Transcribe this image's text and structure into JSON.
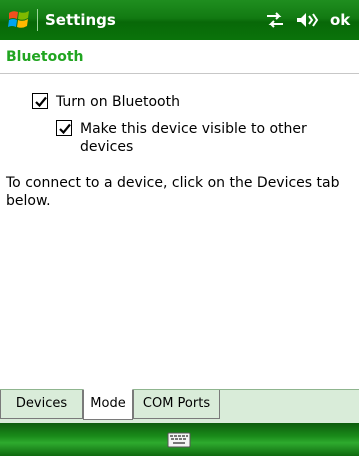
{
  "titlebar": {
    "title": "Settings",
    "ok_label": "ok",
    "icons": [
      "windows-start-icon",
      "connectivity-icon",
      "volume-icon"
    ]
  },
  "header": {
    "title": "Bluetooth"
  },
  "options": {
    "turn_on": {
      "label": "Turn on Bluetooth",
      "checked": true
    },
    "visible": {
      "label": "Make this device visible to other devices",
      "checked": true
    }
  },
  "info_text": "To connect to a device, click on the Devices tab below.",
  "tabs": [
    {
      "label": "Devices",
      "active": false
    },
    {
      "label": "Mode",
      "active": true
    },
    {
      "label": "COM Ports",
      "active": false
    }
  ],
  "bottombar": {
    "icon": "keyboard-icon"
  },
  "colors": {
    "title_bg": "#0a730a",
    "header_text": "#21a521",
    "tab_bg": "#d9ecd9"
  }
}
